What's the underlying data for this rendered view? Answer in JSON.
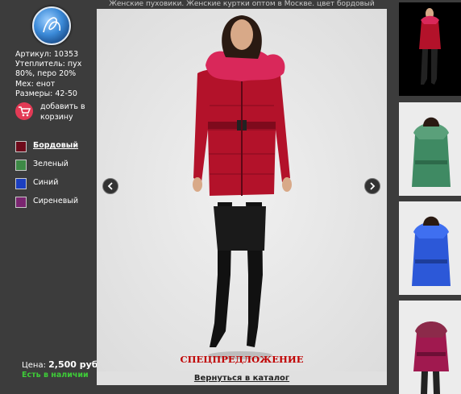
{
  "header": {
    "title": "Женские пуховики. Женские куртки оптом в Москве. цвет бордовый"
  },
  "product": {
    "specs": [
      "Артикул: 10353",
      "Утеплитель: пух 80%, перо 20%",
      "Мех: енот",
      "Размеры: 42-50"
    ],
    "cart_label": "добавить в корзину",
    "price_label": "Цена:",
    "price_value": "2,500 руб.",
    "stock": "Есть в наличии"
  },
  "colors": [
    {
      "name": "Бордовый",
      "hex": "#6e0b1b",
      "active": true
    },
    {
      "name": "Зеленый",
      "hex": "#3d8a46",
      "active": false
    },
    {
      "name": "Синий",
      "hex": "#1c3fbf",
      "active": false
    },
    {
      "name": "Сиреневый",
      "hex": "#7a2570",
      "active": false
    }
  ],
  "main": {
    "special_offer": "СПЕЦПРЕДЛОЖЕНИЕ",
    "back_link": "Вернуться в каталог"
  },
  "thumbnails": [
    {
      "color": "burgundy",
      "jacket": "#b3122a",
      "fur": "#d9285a"
    },
    {
      "color": "green",
      "jacket": "#3f8a63",
      "fur": "#5aa07a"
    },
    {
      "color": "blue",
      "jacket": "#2c58d8",
      "fur": "#3f6ff0"
    },
    {
      "color": "lilac",
      "jacket": "#a0194f",
      "fur": "#8c2a4a"
    }
  ],
  "icons": {
    "logo": "brand-logo-icon",
    "cart": "shopping-cart-icon",
    "prev": "chevron-left-icon",
    "next": "chevron-right-icon"
  }
}
